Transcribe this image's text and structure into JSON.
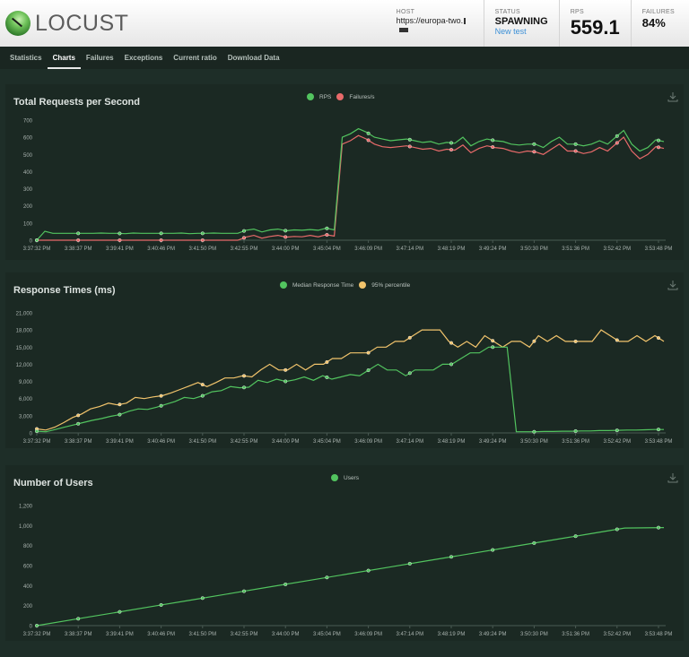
{
  "app": {
    "logo_text": "LOCUST"
  },
  "header": {
    "host_label": "HOST",
    "host_value": "https://europa-two.",
    "status_label": "STATUS",
    "status_value": "SPAWNING",
    "new_test_link": "New test",
    "rps_label": "RPS",
    "rps_value": "559.1",
    "failures_label": "FAILURES",
    "failures_value": "84%"
  },
  "tabs": [
    {
      "label": "Statistics",
      "active": false
    },
    {
      "label": "Charts",
      "active": true
    },
    {
      "label": "Failures",
      "active": false
    },
    {
      "label": "Exceptions",
      "active": false
    },
    {
      "label": "Current ratio",
      "active": false
    },
    {
      "label": "Download Data",
      "active": false
    }
  ],
  "colors": {
    "green": "#52c45f",
    "red": "#e86a6a",
    "yellow": "#f2c46c"
  },
  "chart_data": [
    {
      "id": "rps",
      "type": "line",
      "title": "Total Requests per Second",
      "legend": [
        "RPS",
        "Failures/s"
      ],
      "ylim": [
        0,
        700
      ],
      "yticks": [
        "0",
        "100",
        "200",
        "300",
        "400",
        "500",
        "600",
        "700"
      ],
      "ytick_values": [
        0,
        100,
        200,
        300,
        400,
        500,
        600,
        700
      ],
      "x": [
        "3:37:32 PM",
        "3:38:37 PM",
        "3:39:41 PM",
        "3:40:46 PM",
        "3:41:50 PM",
        "3:42:55 PM",
        "3:44:00 PM",
        "3:45:04 PM",
        "3:46:09 PM",
        "3:47:14 PM",
        "3:48:19 PM",
        "3:49:24 PM",
        "3:50:30 PM",
        "3:51:36 PM",
        "3:52:42 PM",
        "3:53:48 PM"
      ],
      "series": [
        {
          "name": "RPS",
          "color": "#52c45f",
          "values": [
            0,
            52,
            40,
            40,
            40,
            40,
            40,
            40,
            42,
            40,
            40,
            38,
            42,
            40,
            40,
            40,
            40,
            40,
            42,
            38,
            40,
            40,
            42,
            40,
            40,
            40,
            58,
            65,
            48,
            60,
            65,
            55,
            60,
            58,
            62,
            58,
            70,
            60,
            600,
            620,
            650,
            630,
            600,
            590,
            580,
            585,
            590,
            580,
            570,
            575,
            560,
            570,
            565,
            600,
            550,
            575,
            590,
            580,
            575,
            560,
            555,
            560,
            560,
            540,
            575,
            600,
            560,
            560,
            550,
            560,
            580,
            560,
            600,
            640,
            560,
            520,
            540,
            585,
            575
          ]
        },
        {
          "name": "Failures/s",
          "color": "#e86a6a",
          "values": [
            0,
            0,
            0,
            0,
            0,
            0,
            0,
            0,
            0,
            0,
            0,
            0,
            0,
            0,
            0,
            0,
            0,
            0,
            0,
            0,
            0,
            0,
            0,
            0,
            0,
            0,
            18,
            28,
            12,
            22,
            28,
            18,
            22,
            20,
            28,
            20,
            32,
            24,
            560,
            580,
            610,
            590,
            560,
            545,
            540,
            545,
            550,
            540,
            530,
            535,
            520,
            530,
            525,
            555,
            510,
            535,
            550,
            540,
            535,
            520,
            510,
            520,
            515,
            500,
            530,
            560,
            520,
            520,
            505,
            515,
            540,
            520,
            560,
            600,
            520,
            475,
            500,
            545,
            535
          ]
        }
      ]
    },
    {
      "id": "response-times",
      "type": "line",
      "title": "Response Times (ms)",
      "legend": [
        "Median Response Time",
        "95% percentile"
      ],
      "ylim": [
        0,
        21000
      ],
      "yticks": [
        "0",
        "3,000",
        "6,000",
        "9,000",
        "12,000",
        "15,000",
        "18,000",
        "21,000"
      ],
      "ytick_values": [
        0,
        3000,
        6000,
        9000,
        12000,
        15000,
        18000,
        21000
      ],
      "x": [
        "3:37:32 PM",
        "3:38:37 PM",
        "3:39:41 PM",
        "3:40:46 PM",
        "3:41:50 PM",
        "3:42:55 PM",
        "3:44:00 PM",
        "3:45:04 PM",
        "3:46:09 PM",
        "3:47:14 PM",
        "3:48:19 PM",
        "3:49:24 PM",
        "3:50:30 PM",
        "3:51:36 PM",
        "3:52:42 PM",
        "3:53:48 PM"
      ],
      "series": [
        {
          "name": "Median Response Time",
          "color": "#52c45f",
          "values": [
            300,
            200,
            600,
            1000,
            1400,
            1800,
            2200,
            2500,
            2900,
            3200,
            3800,
            4200,
            4100,
            4500,
            5000,
            5500,
            6200,
            6000,
            6500,
            7200,
            7400,
            8100,
            7900,
            8000,
            9200,
            8800,
            9400,
            9000,
            9300,
            9800,
            9200,
            10000,
            9400,
            9800,
            10200,
            10000,
            11000,
            12000,
            11000,
            11000,
            10000,
            11000,
            11000,
            11000,
            12000,
            12000,
            13000,
            14000,
            14000,
            15000,
            15000,
            15000,
            200,
            200,
            200,
            250,
            250,
            300,
            300,
            350,
            350,
            400,
            400,
            450,
            500,
            500,
            550,
            600,
            600
          ]
        },
        {
          "name": "95% percentile",
          "color": "#f2c46c",
          "values": [
            700,
            500,
            1000,
            1800,
            2700,
            3300,
            4200,
            4600,
            5200,
            4900,
            5200,
            6200,
            6000,
            6300,
            6500,
            7000,
            7600,
            8200,
            8800,
            8100,
            8800,
            9600,
            9600,
            10000,
            9800,
            11000,
            12000,
            11000,
            11000,
            12000,
            11000,
            12000,
            12000,
            13000,
            13000,
            14000,
            14000,
            14000,
            15000,
            15000,
            16000,
            16000,
            17000,
            18000,
            18000,
            18000,
            16000,
            15000,
            16000,
            15000,
            17000,
            16000,
            15000,
            16000,
            16000,
            15000,
            17000,
            16000,
            17000,
            16000,
            16000,
            16000,
            16000,
            18000,
            17000,
            16000,
            16000,
            17000,
            16000,
            17000,
            16000
          ]
        }
      ]
    },
    {
      "id": "users",
      "type": "line",
      "title": "Number of Users",
      "legend": [
        "Users"
      ],
      "ylim": [
        0,
        1200
      ],
      "yticks": [
        "0",
        "200",
        "400",
        "600",
        "800",
        "1,000",
        "1,200"
      ],
      "ytick_values": [
        0,
        200,
        400,
        600,
        800,
        1000,
        1200
      ],
      "x": [
        "3:37:32 PM",
        "3:38:37 PM",
        "3:39:41 PM",
        "3:40:46 PM",
        "3:41:50 PM",
        "3:42:55 PM",
        "3:44:00 PM",
        "3:45:04 PM",
        "3:46:09 PM",
        "3:47:14 PM",
        "3:48:19 PM",
        "3:49:24 PM",
        "3:50:30 PM",
        "3:51:36 PM",
        "3:52:42 PM",
        "3:53:48 PM"
      ],
      "series": [
        {
          "name": "Users",
          "color": "#52c45f",
          "values": [
            0,
            65,
            130,
            195,
            260,
            325,
            390,
            455,
            520,
            585,
            650,
            715,
            780,
            845,
            910,
            975,
            980
          ]
        }
      ]
    }
  ]
}
